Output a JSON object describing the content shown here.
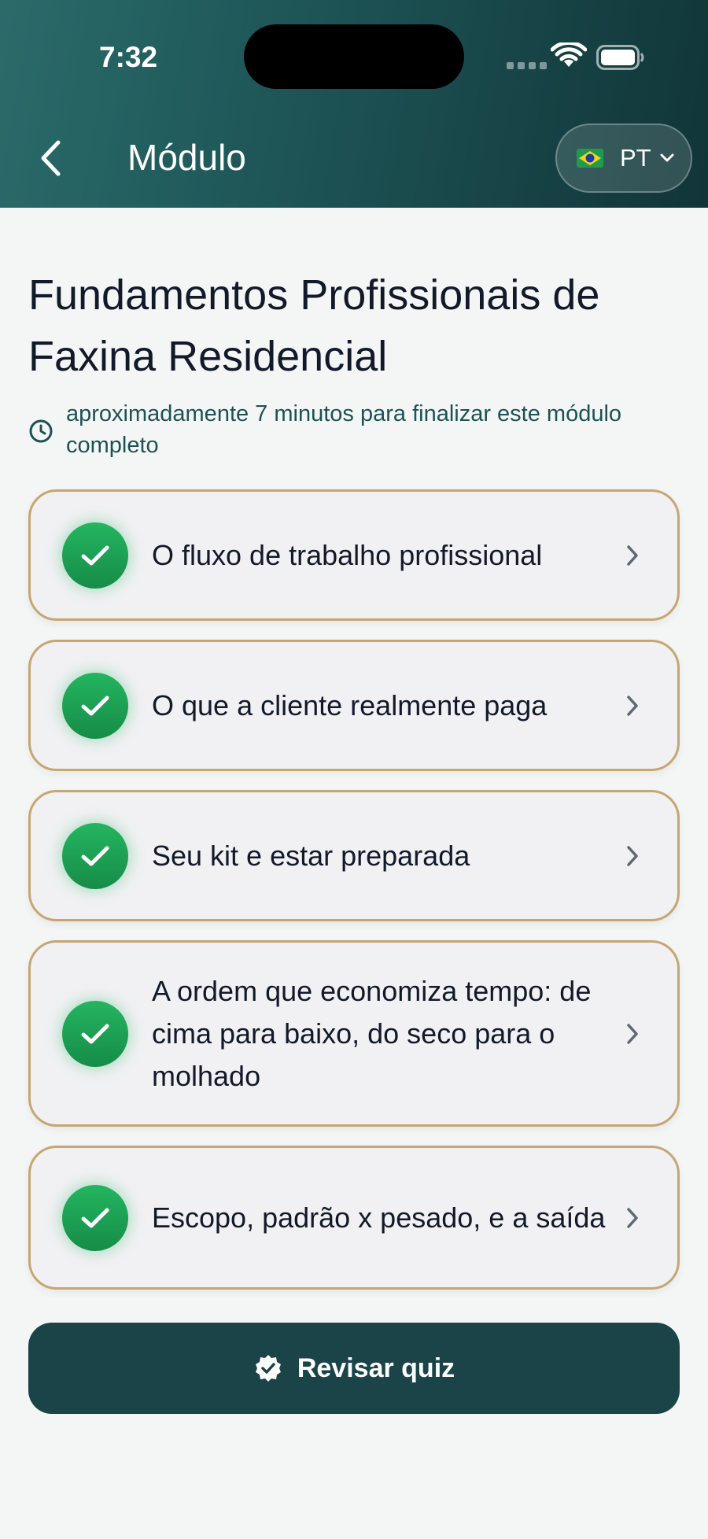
{
  "status_bar": {
    "time": "7:32"
  },
  "header": {
    "title": "Módulo",
    "language": {
      "flag": "brazil-flag-icon",
      "code": "PT"
    }
  },
  "module": {
    "title": "Fundamentos Profissionais de Faxina Residencial",
    "duration_text": "aproximadamente 7 minutos para finalizar este módulo completo"
  },
  "lessons": [
    {
      "label": "O fluxo de trabalho profissional",
      "completed": true
    },
    {
      "label": "O que a cliente realmente paga",
      "completed": true
    },
    {
      "label": "Seu kit e estar preparada",
      "completed": true
    },
    {
      "label": "A ordem que economiza tempo: de cima para baixo, do seco para o molhado",
      "completed": true
    },
    {
      "label": "Escopo, padrão x pesado, e a saída",
      "completed": true
    }
  ],
  "review_button": {
    "label": "Revisar quiz"
  },
  "colors": {
    "header_gradient_start": "#2a6b6a",
    "header_gradient_end": "#113538",
    "card_border": "#c6a672",
    "check_green": "#24b560",
    "button_bg": "#1b4448",
    "duration_text": "#1d5254"
  }
}
